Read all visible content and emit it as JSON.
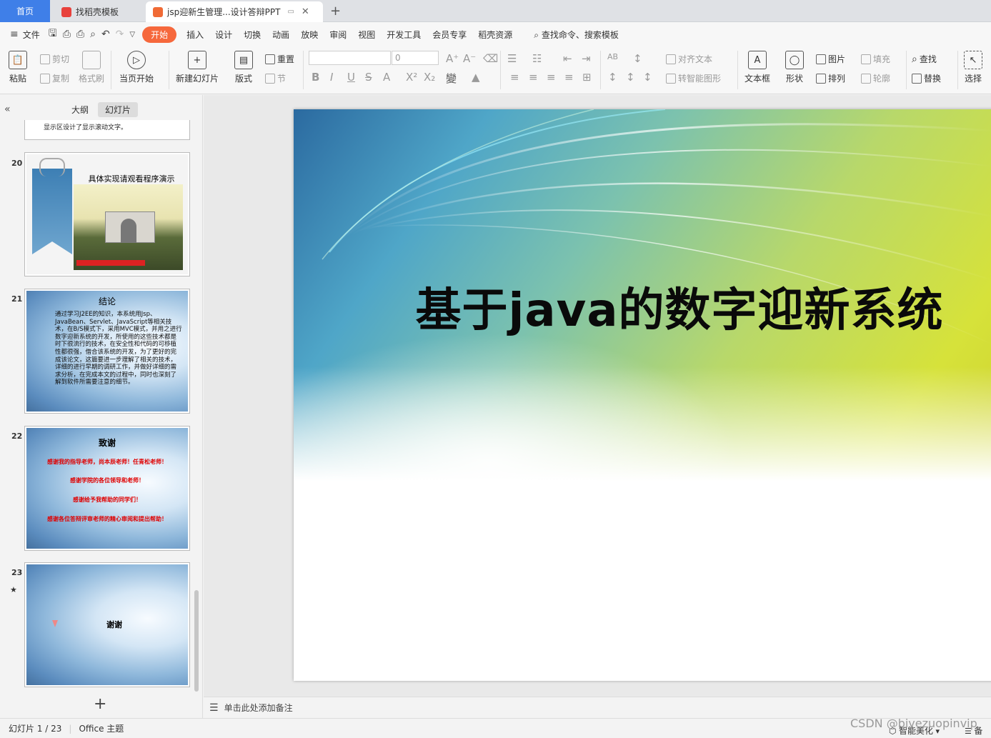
{
  "tabs": {
    "home": "首页",
    "template": "找稻壳模板",
    "document": "jsp迎新生管理...设计答辩PPT"
  },
  "menu": {
    "file": "文件",
    "items": [
      "开始",
      "插入",
      "设计",
      "切换",
      "动画",
      "放映",
      "审阅",
      "视图",
      "开发工具",
      "会员专享",
      "稻壳资源"
    ],
    "search": "查找命令、搜索模板"
  },
  "ribbon": {
    "paste": "粘贴",
    "cut": "剪切",
    "copy": "复制",
    "format_painter": "格式刷",
    "from_current": "当页开始",
    "new_slide": "新建幻灯片",
    "layout": "版式",
    "reset": "重置",
    "section": "节",
    "font_size": "0",
    "align_text": "对齐文本",
    "smart_shape": "转智能图形",
    "text_box": "文本框",
    "shape": "形状",
    "picture": "图片",
    "arrange": "排列",
    "fill": "填充",
    "outline": "轮廓",
    "find": "查找",
    "replace": "替换",
    "select": "选择"
  },
  "panel": {
    "outline_tab": "大纲",
    "slides_tab": "幻灯片",
    "partial_text": "显示区设计了显示滚动文字。",
    "slides": [
      {
        "num": "20",
        "title": "具体实现请观看程序演示"
      },
      {
        "num": "21",
        "title": "结论",
        "body": "通过学习J2EE的知识，本系统用Jsp、JavaBean、Servlet、JavaScript等相关技术，在B/S模式下，采用MVC模式，并用之进行数字迎新系统的开发，所使用的这些技术都是时下很流行的技术，在安全性和代码的可移植性都很强，借合该系统的开发，为了更好的完成该论文，这篇要进一步理解了相关的技术，详细的进行早期的调研工作，并做好详细的需求分析，在完成本文的过程中，同时也深刻了解到软件所需要注意的细节。"
      },
      {
        "num": "22",
        "title": "致谢",
        "lines": [
          "感谢我的指导老师，尚本辰老师！任青松老师！",
          "感谢学院的各位领导和老师！",
          "感谢给予我帮助的同学们！",
          "感谢各位答辩评审老师的精心审阅和提出帮助！"
        ]
      },
      {
        "num": "23",
        "title": "谢谢"
      }
    ]
  },
  "slide": {
    "title": "基于java的数字迎新系统"
  },
  "notes": {
    "placeholder": "单击此处添加备注"
  },
  "status": {
    "slide_index": "幻灯片 1 / 23",
    "theme": "Office 主题",
    "smart_beautify": "智能美化",
    "notes_btn": "备注"
  },
  "watermark": "CSDN @biyezuopinvip"
}
